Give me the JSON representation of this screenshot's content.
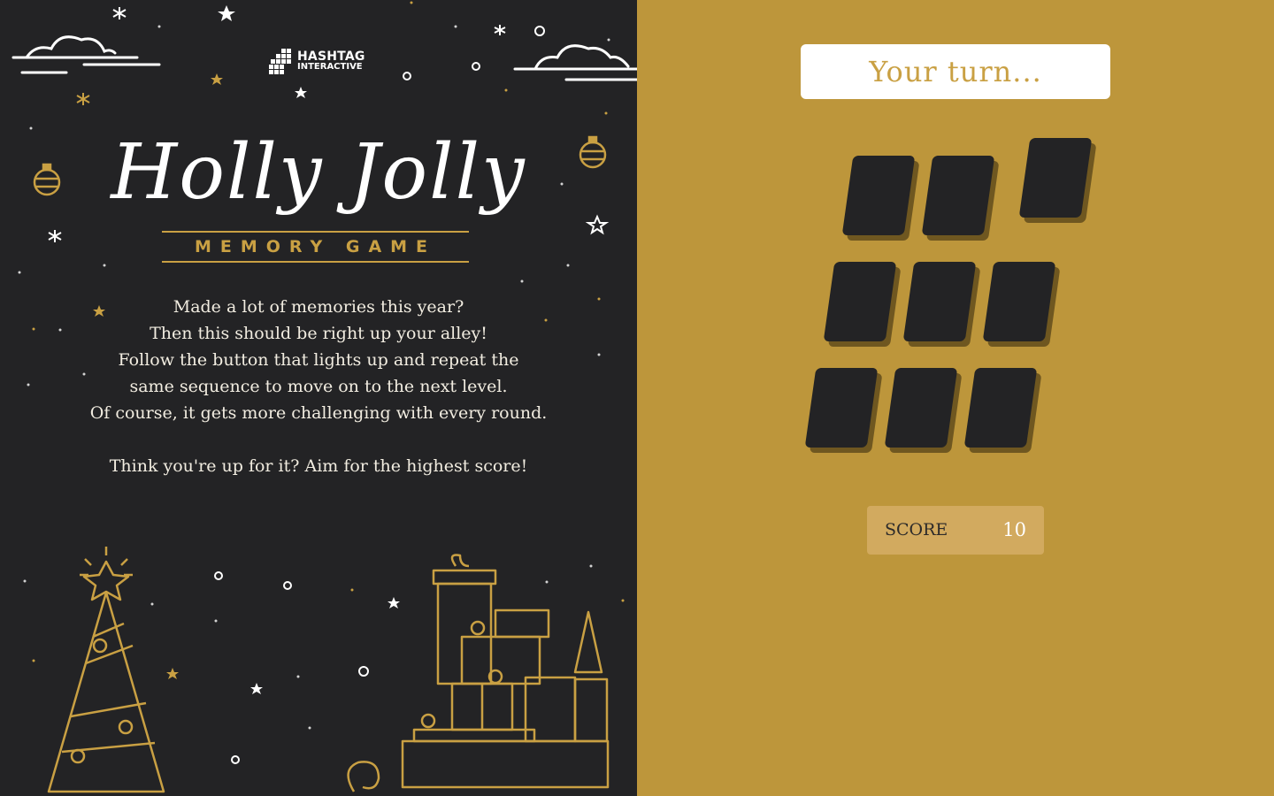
{
  "brand": {
    "line1": "HASHTAG",
    "line2": "INTERACTIVE"
  },
  "title": "Holly Jolly",
  "subtitle": "MEMORY GAME",
  "intro": {
    "lines": [
      "Made a lot of memories this year?",
      "Then this should be right up your alley!",
      "Follow the button that lights up and repeat the",
      "same sequence to move on to the next level.",
      "Of course, it gets more challenging with every round."
    ],
    "cta": "Think you're up for it? Aim for the highest score!"
  },
  "game": {
    "status": "Your turn...",
    "score_label": "SCORE",
    "score_value": "10",
    "card_count": 9,
    "active_card": 3
  },
  "colors": {
    "left_bg": "#232325",
    "right_bg": "#bd963b",
    "gold": "#c9a043",
    "card": "#232325",
    "card_shadow": "#6f5720"
  },
  "icons": [
    "cloud-icon",
    "star-icon",
    "ornament-icon",
    "christmas-tree-icon",
    "gift-stack-icon",
    "hashtag-logo-icon"
  ]
}
